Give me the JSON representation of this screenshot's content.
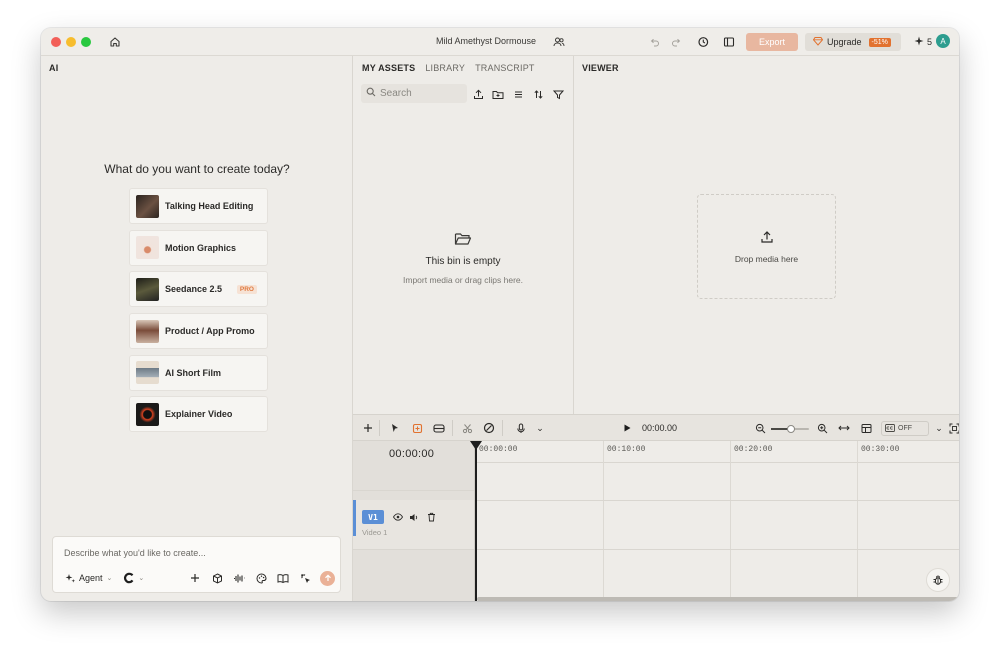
{
  "titlebar": {
    "document_title": "Mild Amethyst Dormouse",
    "export_label": "Export",
    "upgrade_label": "Upgrade",
    "discount_label": "-51%",
    "credits": "5",
    "avatar_initial": "A"
  },
  "ai_panel": {
    "title": "AI",
    "heading": "What do you want to create today?",
    "templates": [
      {
        "label": "Talking Head Editing",
        "thumb_color": "#4a3b33"
      },
      {
        "label": "Motion Graphics",
        "thumb_color": "#e9d8d0"
      },
      {
        "label": "Seedance 2.5",
        "badge": "PRO",
        "thumb_color": "#3a3a2c"
      },
      {
        "label": "Product / App Promo",
        "thumb_color": "#b7a08e"
      },
      {
        "label": "AI Short Film",
        "thumb_color": "#8d9aa6"
      },
      {
        "label": "Explainer Video",
        "thumb_color": "#1b1a19"
      }
    ],
    "chat": {
      "placeholder": "Describe what you'd like to create...",
      "agent_label": "Agent"
    }
  },
  "assets_panel": {
    "tabs": [
      "MY ASSETS",
      "LIBRARY",
      "TRANSCRIPT"
    ],
    "active_tab": "MY ASSETS",
    "search_placeholder": "Search",
    "empty_title": "This bin is empty",
    "empty_subtitle": "Import media or drag clips here."
  },
  "viewer": {
    "title": "VIEWER",
    "drop_label": "Drop media here"
  },
  "timeline": {
    "playback_time": "00:00.00",
    "current_time": "00:00:00",
    "captions_label": "OFF",
    "ruler_labels": [
      "00:00:00",
      "00:10:00",
      "00:20:00",
      "00:30:00"
    ],
    "track": {
      "chip": "V1",
      "name": "Video 1"
    }
  },
  "colors": {
    "accent": "#e2722f",
    "export_bg": "#e8b7a0",
    "track_blue": "#5b8fd6",
    "panel_bg": "#eeece8"
  }
}
